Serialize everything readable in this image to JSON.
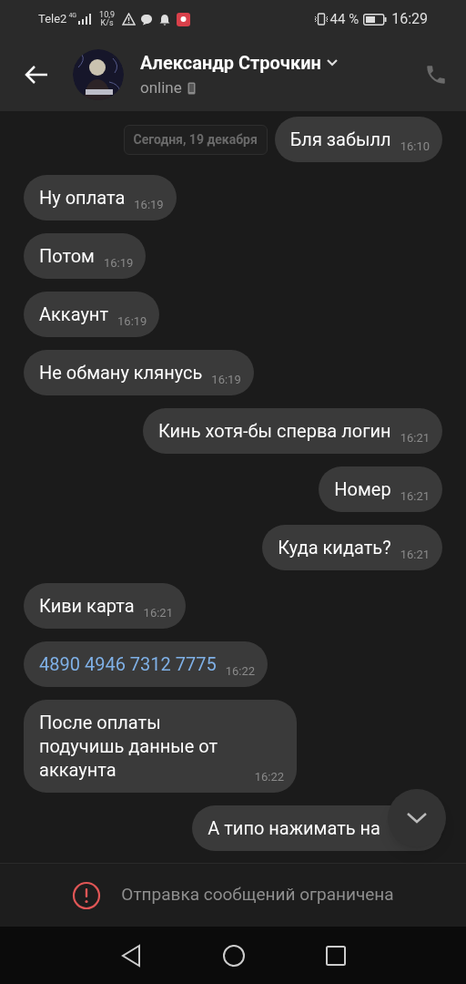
{
  "status_bar": {
    "carrier": "Tele2",
    "network": "4G",
    "speed": "10,9",
    "speed_unit": "K/s",
    "battery": "44 %",
    "time": "16:29"
  },
  "header": {
    "name": "Александр Строчкин",
    "presence": "online"
  },
  "date_chip": "Сегодня, 19 декабря",
  "messages": [
    {
      "outgoing": true,
      "kind": "text",
      "text": "Бля забылл",
      "time": "16:10"
    },
    {
      "outgoing": false,
      "kind": "text",
      "text": "Ну оплата",
      "time": "16:19"
    },
    {
      "outgoing": false,
      "kind": "text",
      "text": "Потом",
      "time": "16:19"
    },
    {
      "outgoing": false,
      "kind": "text",
      "text": "Аккаунт",
      "time": "16:19"
    },
    {
      "outgoing": false,
      "kind": "text",
      "text": "Не обману клянусь",
      "time": "16:19"
    },
    {
      "outgoing": true,
      "kind": "text",
      "text": "Кинь хотя-бы сперва логин",
      "time": "16:21"
    },
    {
      "outgoing": true,
      "kind": "text",
      "text": "Номер",
      "time": "16:21"
    },
    {
      "outgoing": true,
      "kind": "text",
      "text": "Куда кидать?",
      "time": "16:21"
    },
    {
      "outgoing": false,
      "kind": "text",
      "text": "Киви карта",
      "time": "16:21"
    },
    {
      "outgoing": false,
      "kind": "link",
      "text": "4890 4946 7312 7775",
      "time": "16:22"
    },
    {
      "outgoing": false,
      "kind": "text",
      "text": "После оплаты подучишь данные от аккаунта",
      "time": "16:22"
    },
    {
      "outgoing": true,
      "kind": "text",
      "text": "А типо нажимать на"
    }
  ],
  "notice": "Отправка сообщений ограничена"
}
